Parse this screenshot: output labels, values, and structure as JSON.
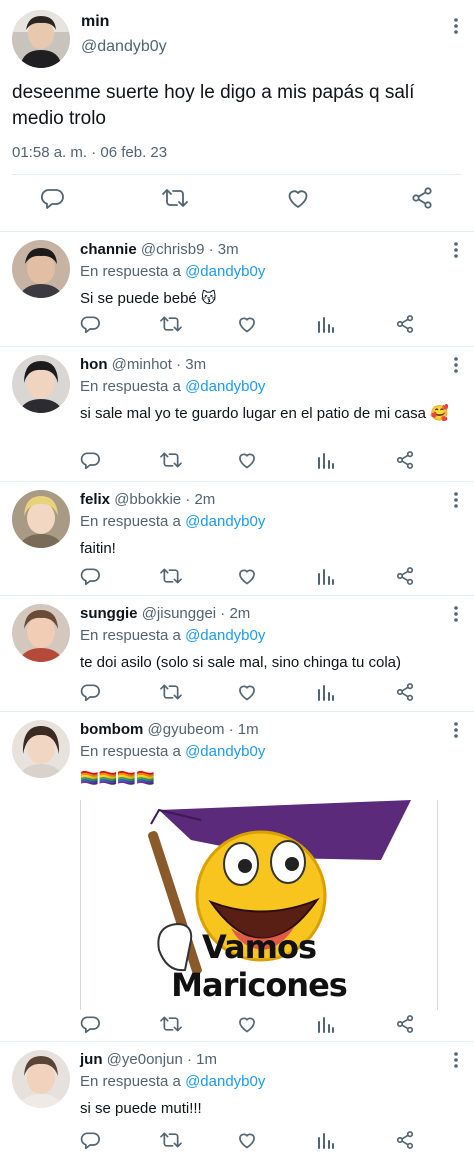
{
  "colors": {
    "accent": "#1d9bf0",
    "muted": "#536471",
    "divider": "#e6ecf0",
    "text": "#0f1419"
  },
  "icons": {
    "reply": "comment-icon",
    "retweet": "retweet-icon",
    "like": "heart-icon",
    "share": "share-icon",
    "views": "analytics-icon",
    "more": "vertical-dots-icon"
  },
  "main_tweet": {
    "name": "min",
    "handle": "@dandyb0y",
    "text": "deseenme suerte hoy le digo a mis papás q salí medio trolo",
    "timestamp": "01:58 a. m. · 06 feb. 23"
  },
  "replies": [
    {
      "name": "channie",
      "handle": "@chrisb9",
      "time": "3m",
      "in_reply_label": "En respuesta a",
      "in_reply_handle": "@dandyb0y",
      "text": "Si se puede bebé 😽"
    },
    {
      "name": "hon",
      "handle": "@minhot",
      "time": "3m",
      "in_reply_label": "En respuesta a",
      "in_reply_handle": "@dandyb0y",
      "text": "si sale mal yo te guardo lugar en el patio de mi casa 🥰"
    },
    {
      "name": "felix",
      "handle": "@bbokkie",
      "time": "2m",
      "in_reply_label": "En respuesta a",
      "in_reply_handle": "@dandyb0y",
      "text": "faitin!"
    },
    {
      "name": "sunggie",
      "handle": "@jisunggei",
      "time": "2m",
      "in_reply_label": "En respuesta a",
      "in_reply_handle": "@dandyb0y",
      "text": "te doi asilo (solo si sale mal, sino chinga tu cola)"
    },
    {
      "name": "bombom",
      "handle": "@gyubeom",
      "time": "1m",
      "in_reply_label": "En respuesta a",
      "in_reply_handle": "@dandyb0y",
      "text": "🏳️‍🌈🏳️‍🌈🏳️‍🌈🏳️‍🌈",
      "media": {
        "caption_line1": "Vamos",
        "caption_line2": "Maricones"
      }
    },
    {
      "name": "jun",
      "handle": "@ye0onjun",
      "time": "1m",
      "in_reply_label": "En respuesta a",
      "in_reply_handle": "@dandyb0y",
      "text": "si se puede muti!!!"
    }
  ]
}
